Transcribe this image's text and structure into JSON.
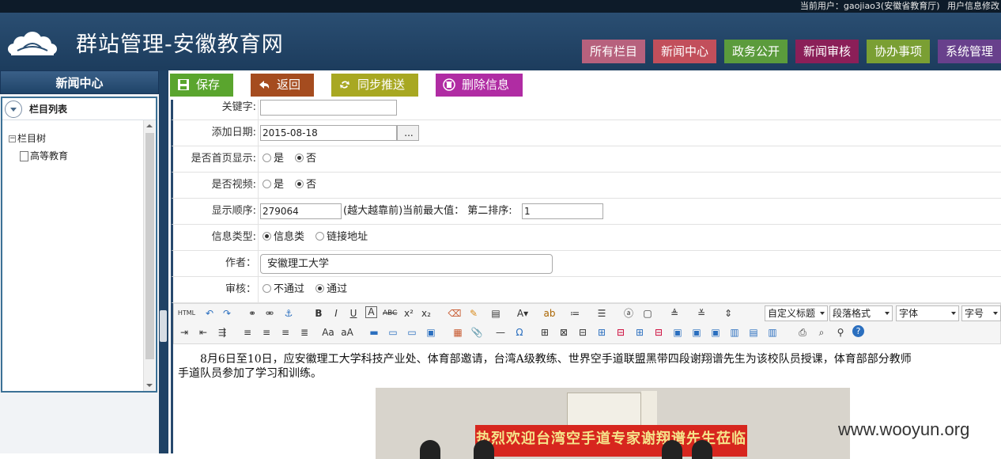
{
  "user_bar": {
    "current_user": "当前用户：gaojiao3(安徽省教育厅)",
    "info_edit": "用户信息修改"
  },
  "header": {
    "site_title": "群站管理-安徽教育网",
    "nav_tabs": [
      {
        "label": "所有栏目",
        "color": "#b7617d"
      },
      {
        "label": "新闻中心",
        "color": "#c24f5b"
      },
      {
        "label": "政务公开",
        "color": "#5b9b3c"
      },
      {
        "label": "新闻审核",
        "color": "#8b1f58"
      },
      {
        "label": "协办事项",
        "color": "#7a9f33"
      },
      {
        "label": "系统管理",
        "color": "#68408c"
      }
    ]
  },
  "sidebar": {
    "title": "新闻中心",
    "subtitle": "栏目列表",
    "tree_root": "栏目树",
    "tree_items": [
      "高等教育"
    ]
  },
  "toolbar": {
    "buttons": [
      {
        "label": "保存",
        "icon": "save-icon",
        "color": "#5aa52e"
      },
      {
        "label": "返回",
        "icon": "return-icon",
        "color": "#a54c1f"
      },
      {
        "label": "同步推送",
        "icon": "sync-icon",
        "color": "#a8a822"
      },
      {
        "label": "删除信息",
        "icon": "delete-icon",
        "color": "#b02ca3"
      }
    ]
  },
  "form": {
    "keywords": {
      "label": "关键字:",
      "value": ""
    },
    "add_date": {
      "label": "添加日期:",
      "value": "2015-08-18",
      "picker": "..."
    },
    "homepage": {
      "label": "是否首页显示:",
      "options": [
        "是",
        "否"
      ],
      "selected": "否"
    },
    "video": {
      "label": "是否视频:",
      "options": [
        "是",
        "否"
      ],
      "selected": "否"
    },
    "order": {
      "label": "显示顺序:",
      "value": "279064",
      "hint": "(越大越靠前)当前最大值：",
      "second_label": "第二排序:",
      "second_value": "1"
    },
    "info_type": {
      "label": "信息类型:",
      "options": [
        "信息类",
        "链接地址"
      ],
      "selected": "信息类"
    },
    "author": {
      "label": "作者：",
      "value": "安徽理工大学"
    },
    "audit": {
      "label": "审核：",
      "options": [
        "不通过",
        "通过"
      ],
      "selected": "通过"
    }
  },
  "editor": {
    "html_label": "HTML",
    "selects": [
      "自定义标题",
      "段落格式",
      "字体",
      "字号"
    ],
    "content_line1": "　　8月6日至10日，应安徽理工大学科技产业处、体育部邀请，台湾A级教练、世界空手道联盟黑带四段谢翔谱先生为该校队员授课，体育部部分教师",
    "content_line2": "手道队员参加了学习和训练。",
    "photo_banner": "热烈欢迎台湾空手道专家谢翔谱先生莅临我校"
  },
  "watermark": "www.wooyun.org"
}
